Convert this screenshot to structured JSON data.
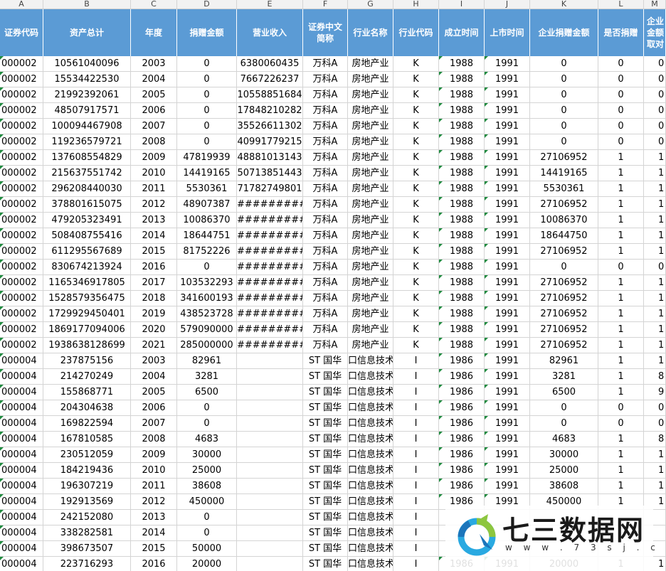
{
  "column_letters": [
    "A",
    "B",
    "C",
    "D",
    "E",
    "F",
    "G",
    "H",
    "I",
    "J",
    "K",
    "L",
    "M"
  ],
  "headers": [
    "证券代码",
    "资产总计",
    "年度",
    "捐赠金额",
    "营业收入",
    "证券中文\n简称",
    "行业名称",
    "行业代码",
    "成立时间",
    "上市时间",
    "企业捐赠金额",
    "是否捐赠",
    "企业\n金额\n取对"
  ],
  "rows": [
    [
      "000002",
      "10561040096",
      "2003",
      "0",
      "6380060435",
      "万科A",
      "房地产业",
      "K",
      "1988",
      "1991",
      "0",
      "0",
      "0"
    ],
    [
      "000002",
      "15534422530",
      "2004",
      "0",
      "7667226237",
      "万科A",
      "房地产业",
      "K",
      "1988",
      "1991",
      "0",
      "0",
      "0"
    ],
    [
      "000002",
      "21992392061",
      "2005",
      "0",
      "10558851684",
      "万科A",
      "房地产业",
      "K",
      "1988",
      "1991",
      "0",
      "0",
      "0"
    ],
    [
      "000002",
      "48507917571",
      "2006",
      "0",
      "17848210282",
      "万科A",
      "房地产业",
      "K",
      "1988",
      "1991",
      "0",
      "0",
      "0"
    ],
    [
      "000002",
      "100094467908",
      "2007",
      "0",
      "35526611302",
      "万科A",
      "房地产业",
      "K",
      "1988",
      "1991",
      "0",
      "0",
      "0"
    ],
    [
      "000002",
      "119236579721",
      "2008",
      "0",
      "40991779215",
      "万科A",
      "房地产业",
      "K",
      "1988",
      "1991",
      "0",
      "0",
      "0"
    ],
    [
      "000002",
      "137608554829",
      "2009",
      "47819939",
      "48881013143",
      "万科A",
      "房地产业",
      "K",
      "1988",
      "1991",
      "27106952",
      "1",
      "1"
    ],
    [
      "000002",
      "215637551742",
      "2010",
      "14419165",
      "50713851443",
      "万科A",
      "房地产业",
      "K",
      "1988",
      "1991",
      "14419165",
      "1",
      "1"
    ],
    [
      "000002",
      "296208440030",
      "2011",
      "5530361",
      "71782749801",
      "万科A",
      "房地产业",
      "K",
      "1988",
      "1991",
      "5530361",
      "1",
      "1"
    ],
    [
      "000002",
      "378801615075",
      "2012",
      "48907387",
      "###########",
      "万科A",
      "房地产业",
      "K",
      "1988",
      "1991",
      "27106952",
      "1",
      "1"
    ],
    [
      "000002",
      "479205323491",
      "2013",
      "10086370",
      "###########",
      "万科A",
      "房地产业",
      "K",
      "1988",
      "1991",
      "10086370",
      "1",
      "1"
    ],
    [
      "000002",
      "508408755416",
      "2014",
      "18644751",
      "###########",
      "万科A",
      "房地产业",
      "K",
      "1988",
      "1991",
      "18644750",
      "1",
      "1"
    ],
    [
      "000002",
      "611295567689",
      "2015",
      "81752226",
      "###########",
      "万科A",
      "房地产业",
      "K",
      "1988",
      "1991",
      "27106952",
      "1",
      "1"
    ],
    [
      "000002",
      "830674213924",
      "2016",
      "0",
      "###########",
      "万科A",
      "房地产业",
      "K",
      "1988",
      "1991",
      "0",
      "0",
      "0"
    ],
    [
      "000002",
      "1165346917805",
      "2017",
      "103532293",
      "###########",
      "万科A",
      "房地产业",
      "K",
      "1988",
      "1991",
      "27106952",
      "1",
      "1"
    ],
    [
      "000002",
      "1528579356475",
      "2018",
      "341600193",
      "###########",
      "万科A",
      "房地产业",
      "K",
      "1988",
      "1991",
      "27106952",
      "1",
      "1"
    ],
    [
      "000002",
      "1729929450401",
      "2019",
      "438523728",
      "###########",
      "万科A",
      "房地产业",
      "K",
      "1988",
      "1991",
      "27106952",
      "1",
      "1"
    ],
    [
      "000002",
      "1869177094006",
      "2020",
      "579090000",
      "###########",
      "万科A",
      "房地产业",
      "K",
      "1988",
      "1991",
      "27106952",
      "1",
      "1"
    ],
    [
      "000002",
      "1938638128699",
      "2021",
      "285000000",
      "###########",
      "万科A",
      "房地产业",
      "K",
      "1988",
      "1991",
      "27106952",
      "1",
      "1"
    ],
    [
      "000004",
      "237875156",
      "2003",
      "82961",
      "",
      "ST 国华",
      "口信息技术服",
      "I",
      "1986",
      "1991",
      "82961",
      "1",
      "1"
    ],
    [
      "000004",
      "214270249",
      "2004",
      "3281",
      "",
      "ST 国华",
      "口信息技术服",
      "I",
      "1986",
      "1991",
      "3281",
      "1",
      "8"
    ],
    [
      "000004",
      "155868771",
      "2005",
      "6500",
      "",
      "ST 国华",
      "口信息技术服",
      "I",
      "1986",
      "1991",
      "6500",
      "1",
      "9"
    ],
    [
      "000004",
      "204304638",
      "2006",
      "0",
      "",
      "ST 国华",
      "口信息技术服",
      "I",
      "1986",
      "1991",
      "0",
      "0",
      "0"
    ],
    [
      "000004",
      "169822594",
      "2007",
      "0",
      "",
      "ST 国华",
      "口信息技术服",
      "I",
      "1986",
      "1991",
      "0",
      "0",
      "0"
    ],
    [
      "000004",
      "167810585",
      "2008",
      "4683",
      "",
      "ST 国华",
      "口信息技术服",
      "I",
      "1986",
      "1991",
      "4683",
      "1",
      "8"
    ],
    [
      "000004",
      "230512059",
      "2009",
      "30000",
      "",
      "ST 国华",
      "口信息技术服",
      "I",
      "1986",
      "1991",
      "30000",
      "1",
      "1"
    ],
    [
      "000004",
      "184219436",
      "2010",
      "25000",
      "",
      "ST 国华",
      "口信息技术服",
      "I",
      "1986",
      "1991",
      "25000",
      "1",
      "1"
    ],
    [
      "000004",
      "196307219",
      "2011",
      "38608",
      "",
      "ST 国华",
      "口信息技术服",
      "I",
      "1986",
      "1991",
      "38608",
      "1",
      "1"
    ],
    [
      "000004",
      "192913569",
      "2012",
      "450000",
      "",
      "ST 国华",
      "口信息技术服",
      "I",
      "1986",
      "1991",
      "450000",
      "1",
      "1"
    ],
    [
      "000004",
      "242152080",
      "2013",
      "0",
      "",
      "ST 国华",
      "口信息技术服",
      "I",
      "",
      "",
      "",
      "",
      ""
    ],
    [
      "000004",
      "338282581",
      "2014",
      "0",
      "",
      "ST 国华",
      "口信息技术服",
      "I",
      "",
      "",
      "",
      "",
      ""
    ],
    [
      "000004",
      "398673507",
      "2015",
      "50000",
      "",
      "ST 国华",
      "口信息技术服",
      "I",
      "",
      "",
      "",
      "",
      ""
    ],
    [
      "000004",
      "223716293",
      "2016",
      "20000",
      "",
      "ST 国华",
      "口信息技术服",
      "I",
      "1986",
      "1991",
      "20000",
      "1",
      "1"
    ]
  ],
  "watermark": {
    "title": "七三数据网",
    "url": "w w w . 7 3 s j . c o m"
  },
  "colors": {
    "header_bg": "#5b9bd5",
    "header_text": "#ffffff",
    "grid": "#d4d4d4",
    "error_triangle": "#1e8a3e"
  }
}
